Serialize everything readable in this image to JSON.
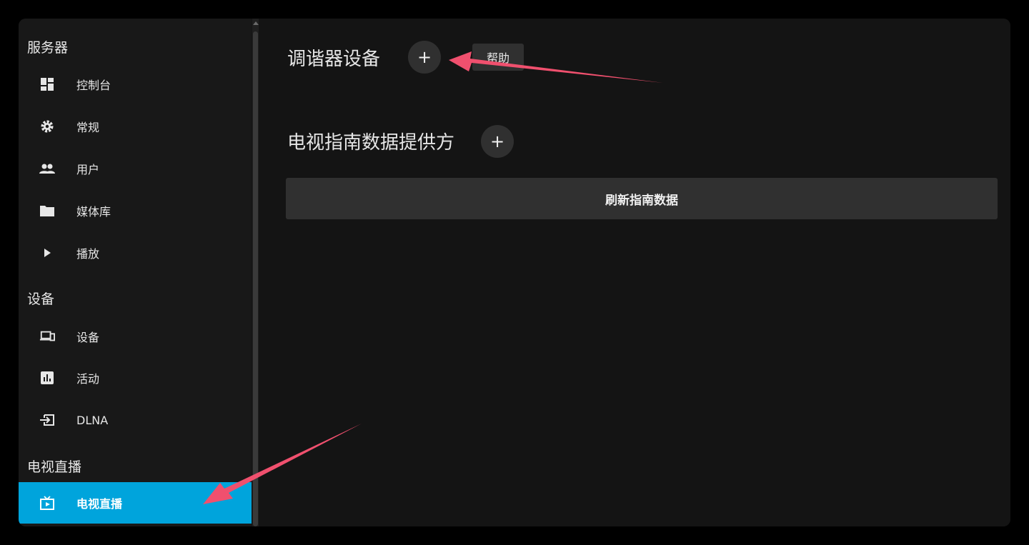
{
  "colors": {
    "accent": "#00a4dc",
    "annotation_arrow": "#f0506e"
  },
  "sidebar": {
    "sections": [
      {
        "title": "服务器",
        "items": [
          {
            "label": "控制台",
            "icon": "dashboard-icon"
          },
          {
            "label": "常规",
            "icon": "gear-icon"
          },
          {
            "label": "用户",
            "icon": "people-icon"
          },
          {
            "label": "媒体库",
            "icon": "folder-icon"
          },
          {
            "label": "播放",
            "icon": "play-icon"
          }
        ]
      },
      {
        "title": "设备",
        "items": [
          {
            "label": "设备",
            "icon": "devices-icon"
          },
          {
            "label": "活动",
            "icon": "chart-icon"
          },
          {
            "label": "DLNA",
            "icon": "input-icon"
          }
        ]
      },
      {
        "title": "电视直播",
        "items": [
          {
            "label": "电视直播",
            "icon": "live-tv-icon",
            "active": true
          }
        ]
      }
    ]
  },
  "main": {
    "tuner_heading": "调谐器设备",
    "add_symbol": "+",
    "help_label": "帮助",
    "guide_heading": "电视指南数据提供方",
    "refresh_label": "刷新指南数据"
  }
}
